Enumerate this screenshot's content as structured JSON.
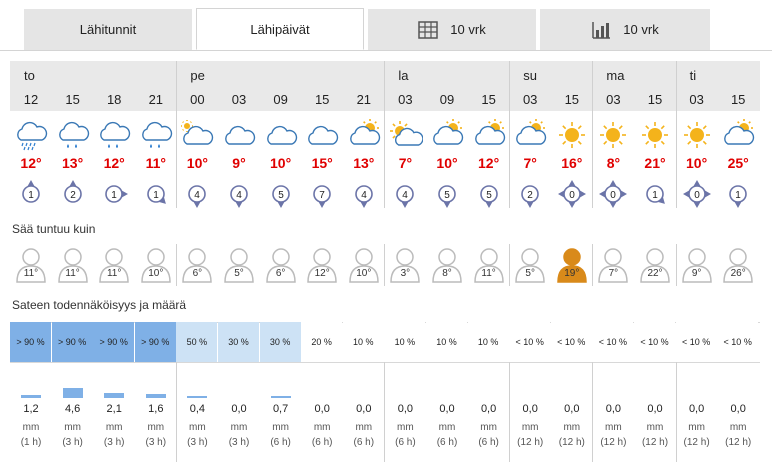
{
  "tabs": [
    {
      "label": "Lähitunnit",
      "icon": ""
    },
    {
      "label": "Lähipäivät",
      "icon": ""
    },
    {
      "label": "10 vrk",
      "icon": "table-icon"
    },
    {
      "label": "10 vrk",
      "icon": "bar-chart-icon"
    }
  ],
  "colors": {
    "temp": "#e00000",
    "wind": "#6b74a8",
    "rain_prob_high": "#7fb0e6",
    "rain_prob_mid": "#cde2f5",
    "feels_hot": "#d98a1a",
    "feels_normal": "#cccccc"
  },
  "days": [
    {
      "name": "to",
      "start": 0
    },
    {
      "name": "pe",
      "start": 4
    },
    {
      "name": "la",
      "start": 9
    },
    {
      "name": "su",
      "start": 12
    },
    {
      "name": "ma",
      "start": 14
    },
    {
      "name": "ti",
      "start": 16
    }
  ],
  "hours": [
    {
      "h": "12",
      "icon": "cloud-sleet-icon",
      "temp": "12°",
      "wind": "1",
      "wdir": 180,
      "feels": "11°",
      "hot": false,
      "prob": "> 90 %",
      "pl": "high",
      "amt": "1,2",
      "bar": 0.26,
      "unit": "mm",
      "per": "(1 h)"
    },
    {
      "h": "15",
      "icon": "cloud-rain-icon",
      "temp": "13°",
      "wind": "2",
      "wdir": 180,
      "feels": "11°",
      "hot": false,
      "prob": "> 90 %",
      "pl": "high",
      "amt": "4,6",
      "bar": 1.0,
      "unit": "mm",
      "per": "(3 h)"
    },
    {
      "h": "18",
      "icon": "cloud-rain-icon",
      "temp": "12°",
      "wind": "1",
      "wdir": 270,
      "feels": "11°",
      "hot": false,
      "prob": "> 90 %",
      "pl": "high",
      "amt": "2,1",
      "bar": 0.46,
      "unit": "mm",
      "per": "(3 h)"
    },
    {
      "h": "21",
      "icon": "cloud-rain-icon",
      "temp": "11°",
      "wind": "1",
      "wdir": 315,
      "feels": "10°",
      "hot": false,
      "prob": "> 90 %",
      "pl": "high",
      "amt": "1,6",
      "bar": 0.35,
      "unit": "mm",
      "per": "(3 h)"
    },
    {
      "h": "00",
      "icon": "partly-cloudy-moon-icon",
      "temp": "10°",
      "wind": "4",
      "wdir": 0,
      "feels": "6°",
      "hot": false,
      "prob": "50 %",
      "pl": "mid",
      "amt": "0,4",
      "bar": 0.09,
      "unit": "mm",
      "per": "(3 h)"
    },
    {
      "h": "03",
      "icon": "cloud-icon",
      "temp": "9°",
      "wind": "4",
      "wdir": 0,
      "feels": "5°",
      "hot": false,
      "prob": "30 %",
      "pl": "mid",
      "amt": "0,0",
      "bar": 0,
      "unit": "mm",
      "per": "(3 h)"
    },
    {
      "h": "09",
      "icon": "cloud-icon",
      "temp": "10°",
      "wind": "5",
      "wdir": 0,
      "feels": "6°",
      "hot": false,
      "prob": "30 %",
      "pl": "mid",
      "amt": "0,7",
      "bar": 0.15,
      "unit": "mm",
      "per": "(6 h)"
    },
    {
      "h": "15",
      "icon": "cloud-icon",
      "temp": "15°",
      "wind": "7",
      "wdir": 0,
      "feels": "12°",
      "hot": false,
      "prob": "20 %",
      "pl": "none",
      "amt": "0,0",
      "bar": 0,
      "unit": "mm",
      "per": "(6 h)"
    },
    {
      "h": "21",
      "icon": "partly-cloudy-icon",
      "temp": "13°",
      "wind": "4",
      "wdir": 0,
      "feels": "10°",
      "hot": false,
      "prob": "10 %",
      "pl": "none",
      "amt": "0,0",
      "bar": 0,
      "unit": "mm",
      "per": "(6 h)"
    },
    {
      "h": "03",
      "icon": "sun-small-icon",
      "temp": "7°",
      "wind": "4",
      "wdir": 0,
      "feels": "3°",
      "hot": false,
      "prob": "10 %",
      "pl": "none",
      "amt": "0,0",
      "bar": 0,
      "unit": "mm",
      "per": "(6 h)"
    },
    {
      "h": "09",
      "icon": "partly-cloudy-icon",
      "temp": "10°",
      "wind": "5",
      "wdir": 0,
      "feels": "8°",
      "hot": false,
      "prob": "10 %",
      "pl": "none",
      "amt": "0,0",
      "bar": 0,
      "unit": "mm",
      "per": "(6 h)"
    },
    {
      "h": "15",
      "icon": "partly-cloudy-icon",
      "temp": "12°",
      "wind": "5",
      "wdir": 0,
      "feels": "11°",
      "hot": false,
      "prob": "10 %",
      "pl": "none",
      "amt": "0,0",
      "bar": 0,
      "unit": "mm",
      "per": "(6 h)"
    },
    {
      "h": "03",
      "icon": "partly-cloudy-icon",
      "temp": "7°",
      "wind": "2",
      "wdir": 0,
      "feels": "5°",
      "hot": false,
      "prob": "< 10 %",
      "pl": "none",
      "amt": "0,0",
      "bar": 0,
      "unit": "mm",
      "per": "(12 h)"
    },
    {
      "h": "15",
      "icon": "sun-icon",
      "temp": "16°",
      "wind": "0",
      "wdir": -1,
      "feels": "19°",
      "hot": true,
      "prob": "< 10 %",
      "pl": "none",
      "amt": "0,0",
      "bar": 0,
      "unit": "mm",
      "per": "(12 h)"
    },
    {
      "h": "03",
      "icon": "sun-icon",
      "temp": "8°",
      "wind": "0",
      "wdir": -1,
      "feels": "7°",
      "hot": false,
      "prob": "< 10 %",
      "pl": "none",
      "amt": "0,0",
      "bar": 0,
      "unit": "mm",
      "per": "(12 h)"
    },
    {
      "h": "15",
      "icon": "sun-icon",
      "temp": "21°",
      "wind": "1",
      "wdir": 315,
      "feels": "22°",
      "hot": false,
      "prob": "< 10 %",
      "pl": "none",
      "amt": "0,0",
      "bar": 0,
      "unit": "mm",
      "per": "(12 h)"
    },
    {
      "h": "03",
      "icon": "sun-icon",
      "temp": "10°",
      "wind": "0",
      "wdir": -1,
      "feels": "9°",
      "hot": false,
      "prob": "< 10 %",
      "pl": "none",
      "amt": "0,0",
      "bar": 0,
      "unit": "mm",
      "per": "(12 h)"
    },
    {
      "h": "15",
      "icon": "partly-cloudy-icon",
      "temp": "25°",
      "wind": "1",
      "wdir": 0,
      "feels": "26°",
      "hot": false,
      "prob": "< 10 %",
      "pl": "none",
      "amt": "0,0",
      "bar": 0,
      "unit": "mm",
      "per": "(12 h)"
    }
  ],
  "sections": {
    "feels_like": "Sää tuntuu kuin",
    "precip": "Sateen todennäköisyys ja määrä"
  }
}
